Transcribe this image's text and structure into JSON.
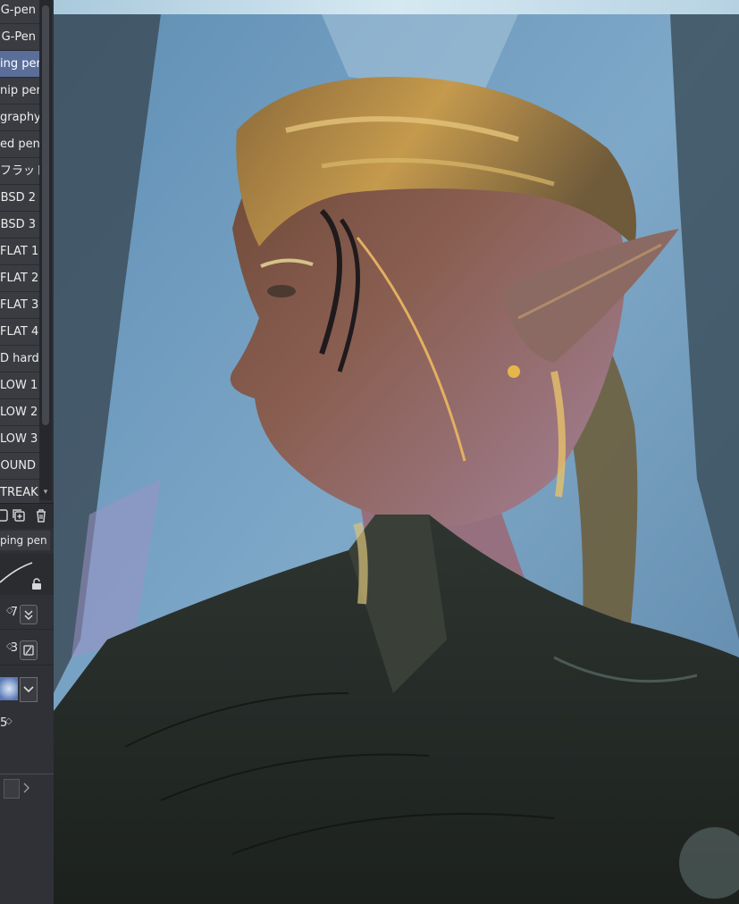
{
  "brush_list": {
    "items": [
      "G-pen",
      "G-Pen",
      "ing pen",
      "nip pen",
      "graphy",
      "ed pen",
      "フラット",
      "BSD 2",
      "BSD 3",
      "FLAT 1",
      "FLAT 2",
      "FLAT 3",
      "FLAT 4",
      "D hard",
      "LOW 1",
      "LOW 2",
      "LOW 3",
      "OUND",
      "TREAK"
    ],
    "selected_index": 2
  },
  "tool_property": {
    "tool_name": "ping pen",
    "rows": [
      {
        "value": "7"
      },
      {
        "value": "3"
      },
      {
        "value": "5"
      }
    ]
  },
  "icons": {
    "copy": "duplicate-icon",
    "delete": "trash-icon",
    "lock": "lock-icon",
    "pressure": "pressure-icon",
    "settings": "settings-icon",
    "dropdown": "chevron-down-icon",
    "next": "chevron-right-icon"
  },
  "colors": {
    "panel_bg": "#2f3136",
    "selected_item": "#5b6e9a",
    "canvas_sky": "#6f9cc0"
  }
}
